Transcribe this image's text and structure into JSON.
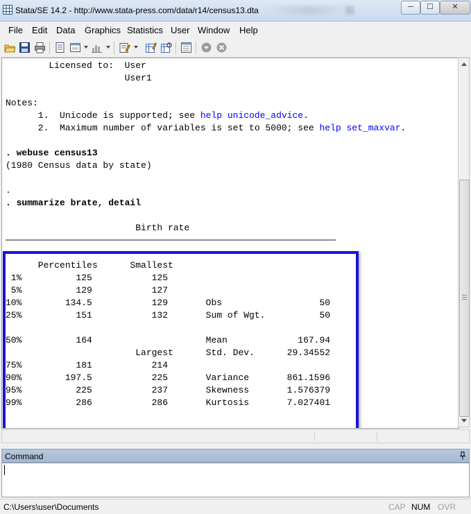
{
  "window": {
    "title": "Stata/SE 14.2 - http://www.stata-press.com/data/r14/census13.dta",
    "minimize_glyph": "─",
    "maximize_glyph": "☐",
    "close_glyph": "✕"
  },
  "menu": [
    "File",
    "Edit",
    "Data",
    "Graphics",
    "Statistics",
    "User",
    "Window",
    "Help"
  ],
  "toolbar_icons": [
    "open-icon",
    "save-icon",
    "print-icon",
    "log-icon",
    "viewer-icon",
    "graph-icon",
    "do-file-editor-icon",
    "data-editor-icon",
    "data-browser-icon",
    "variables-manager-icon",
    "more-icon",
    "break-icon"
  ],
  "results": {
    "lines": [
      [
        {
          "t": "        Licensed to:  User"
        }
      ],
      [
        {
          "t": "                      User1"
        }
      ],
      [
        {
          "t": ""
        }
      ],
      [
        {
          "t": "Notes:"
        }
      ],
      [
        {
          "t": "      1.  Unicode is supported; see "
        },
        {
          "t": "help unicode_advice",
          "link": true
        },
        {
          "t": "."
        }
      ],
      [
        {
          "t": "      2.  Maximum number of variables is set to 5000; see "
        },
        {
          "t": "help set_maxvar",
          "link": true
        },
        {
          "t": "."
        }
      ],
      [
        {
          "t": ""
        }
      ],
      [
        {
          "t": ". webuse census13",
          "cmd": true
        }
      ],
      [
        {
          "t": "(1980 Census data by state)"
        }
      ],
      [
        {
          "t": ""
        }
      ],
      [
        {
          "t": "."
        }
      ],
      [
        {
          "t": ". summarize brate, detail",
          "cmd": true
        }
      ],
      [
        {
          "t": ""
        }
      ],
      [
        {
          "t": "                        Birth rate"
        }
      ],
      [
        {
          "t": "─────────────────────────────────────────────────────────────"
        }
      ],
      [
        {
          "t": ""
        }
      ],
      [
        {
          "t": "      Percentiles      Smallest"
        }
      ],
      [
        {
          "t": " 1%          125           125"
        }
      ],
      [
        {
          "t": " 5%          129           127"
        }
      ],
      [
        {
          "t": "10%        134.5           129       Obs                  50"
        }
      ],
      [
        {
          "t": "25%          151           132       Sum of Wgt.          50"
        }
      ],
      [
        {
          "t": ""
        }
      ],
      [
        {
          "t": "50%          164                     Mean             167.94"
        }
      ],
      [
        {
          "t": "                        Largest      Std. Dev.      29.34552"
        }
      ],
      [
        {
          "t": "75%          181           214"
        }
      ],
      [
        {
          "t": "90%        197.5           225       Variance       861.1596"
        }
      ],
      [
        {
          "t": "95%          225           237       Skewness       1.576379"
        }
      ],
      [
        {
          "t": "99%          286           286       Kurtosis       7.027401"
        }
      ],
      [
        {
          "t": ""
        }
      ],
      [
        {
          "t": "."
        }
      ]
    ]
  },
  "command_panel": {
    "title": "Command"
  },
  "statusbar": {
    "path": "C:\\Users\\user\\Documents",
    "flags": [
      {
        "label": "CAP",
        "on": false
      },
      {
        "label": "NUM",
        "on": true
      },
      {
        "label": "OVR",
        "on": false
      }
    ]
  },
  "colors": {
    "highlight_box": "#1a12d8",
    "link": "#0000ff"
  }
}
